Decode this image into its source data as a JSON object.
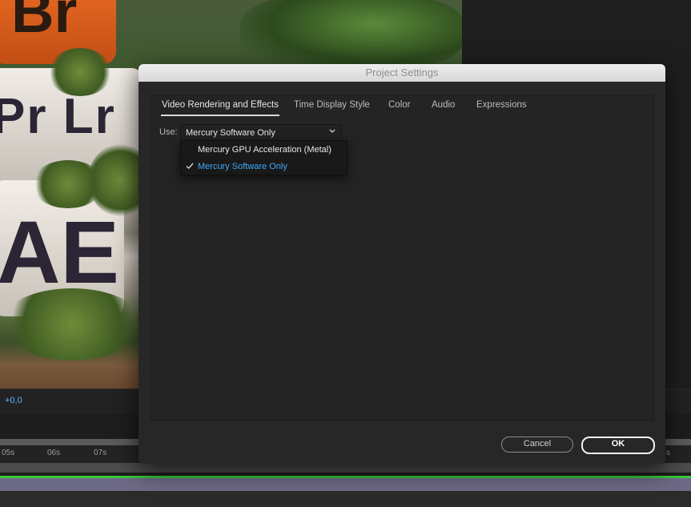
{
  "background": {
    "logos": {
      "br": "Br",
      "pr_lr": "Pr Lr",
      "ae": "AE"
    },
    "status_value": "+0,0",
    "ruler_ticks": [
      "05s",
      "06s",
      "07s"
    ],
    "ruler_tick_right": "s"
  },
  "dialog": {
    "title": "Project Settings",
    "tabs": [
      {
        "label": "Video Rendering and Effects",
        "active": true
      },
      {
        "label": "Time Display Style",
        "active": false
      },
      {
        "label": "Color",
        "active": false
      },
      {
        "label": "Audio",
        "active": false
      },
      {
        "label": "Expressions",
        "active": false
      }
    ],
    "use_label": "Use:",
    "renderer_select": {
      "value": "Mercury Software Only",
      "icon": "chevron-down-icon",
      "options": [
        {
          "label": "Mercury GPU Acceleration (Metal)",
          "selected": false
        },
        {
          "label": "Mercury Software Only",
          "selected": true
        }
      ]
    },
    "buttons": {
      "cancel": "Cancel",
      "ok": "OK"
    },
    "colors": {
      "accent": "#3fa9f5",
      "panel": "#272727",
      "titlebar": "#e2e2e2"
    }
  }
}
